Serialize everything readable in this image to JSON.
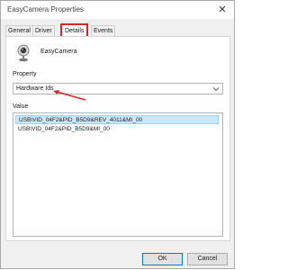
{
  "window": {
    "title": "EasyCamera Properties",
    "close_glyph": "✕"
  },
  "tabs": [
    {
      "label": "General",
      "selected": false
    },
    {
      "label": "Driver",
      "selected": false
    },
    {
      "label": "Details",
      "selected": true
    },
    {
      "label": "Events",
      "selected": false
    }
  ],
  "device": {
    "name": "EasyCamera",
    "icon": "webcam-icon"
  },
  "property": {
    "label": "Property",
    "selected_value": "Hardware Ids"
  },
  "value": {
    "label": "Value",
    "items": [
      "USB\\VID_04F2&PID_B5D9&REV_4011&MI_00",
      "USB\\VID_04F2&PID_B5D9&MI_00"
    ]
  },
  "buttons": {
    "ok_label": "OK",
    "cancel_label": "Cancel"
  },
  "colors": {
    "highlight": "#d9242b",
    "selection": "#cce8ff",
    "accent": "#0078d7"
  }
}
